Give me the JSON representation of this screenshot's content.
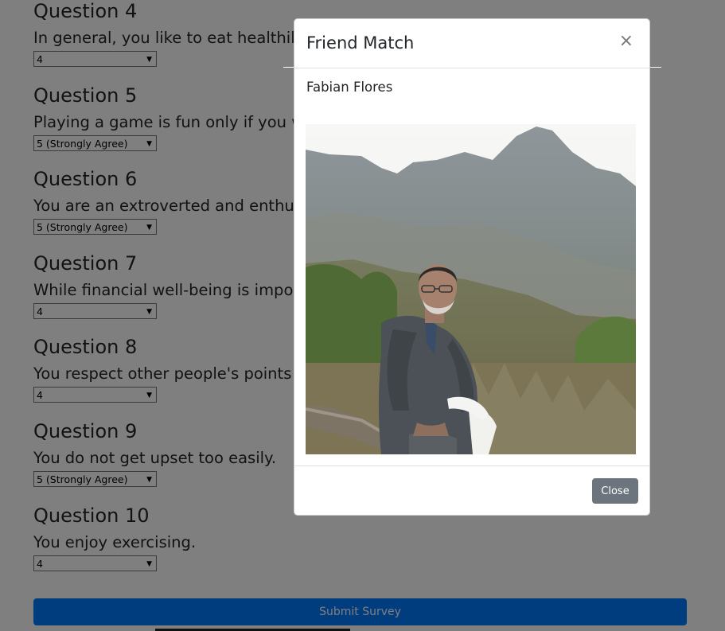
{
  "survey": {
    "questions": [
      {
        "title": "Question 4",
        "text": "In general, you like to eat healthily and be active.",
        "value": "4"
      },
      {
        "title": "Question 5",
        "text": "Playing a game is fun only if you win.",
        "value": "5 (Strongly Agree)"
      },
      {
        "title": "Question 6",
        "text": "You are an extroverted and enthusiastic person.",
        "value": "5 (Strongly Agree)"
      },
      {
        "title": "Question 7",
        "text": "While financial well-being is important, it's not everything in life.",
        "value": "4"
      },
      {
        "title": "Question 8",
        "text": "You respect other people's points of view.",
        "value": "4"
      },
      {
        "title": "Question 9",
        "text": "You do not get upset too easily.",
        "value": "5 (Strongly Agree)"
      },
      {
        "title": "Question 10",
        "text": "You enjoy exercising.",
        "value": "4"
      }
    ],
    "submit_label": "Submit Survey"
  },
  "modal": {
    "title": "Friend Match",
    "close_symbol": "×",
    "match_name": "Fabian Flores",
    "close_label": "Close"
  },
  "colors": {
    "primary": "#007bff",
    "secondary": "#6c757d",
    "backdrop": "rgba(0,0,0,0.5)"
  }
}
